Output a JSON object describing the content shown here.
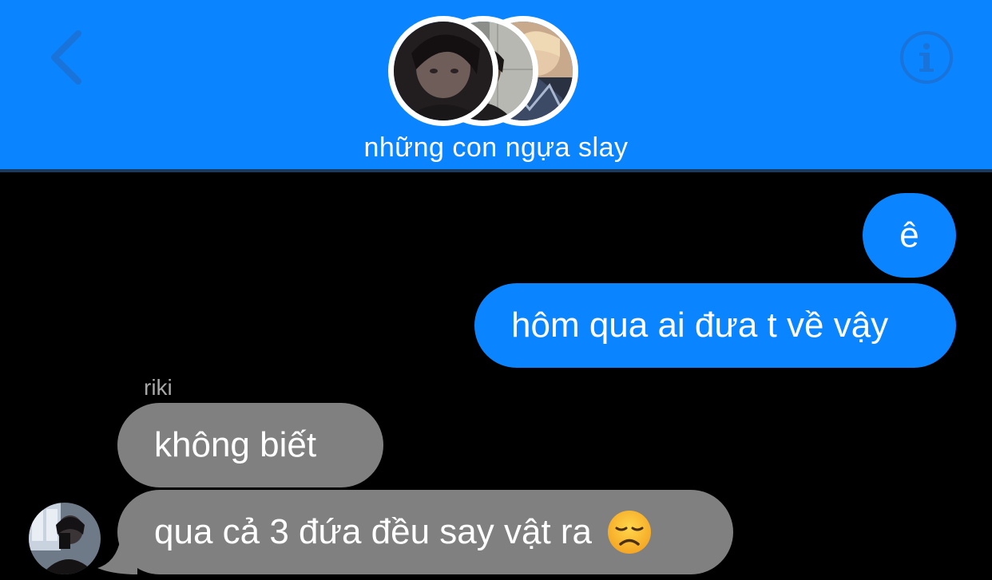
{
  "header": {
    "title": "những con ngựa slay",
    "back_icon": "chevron-left-icon",
    "info_icon": "info-icon",
    "accent_color": "#0a84ff",
    "avatars": [
      "group-member-avatar-1",
      "group-member-avatar-2",
      "group-member-avatar-3"
    ]
  },
  "messages": [
    {
      "direction": "outgoing",
      "text": "ê"
    },
    {
      "direction": "outgoing",
      "text": "hôm qua ai đưa t về vậy"
    },
    {
      "direction": "incoming",
      "sender": "riki",
      "text": "không biết"
    },
    {
      "direction": "incoming",
      "sender": "riki",
      "text": "qua cả 3 đứa đều say vật ra",
      "emoji": "disappointed-face-emoji"
    }
  ],
  "colors": {
    "outgoing_bubble": "#0a84ff",
    "incoming_bubble": "#808080",
    "background": "#000000"
  }
}
